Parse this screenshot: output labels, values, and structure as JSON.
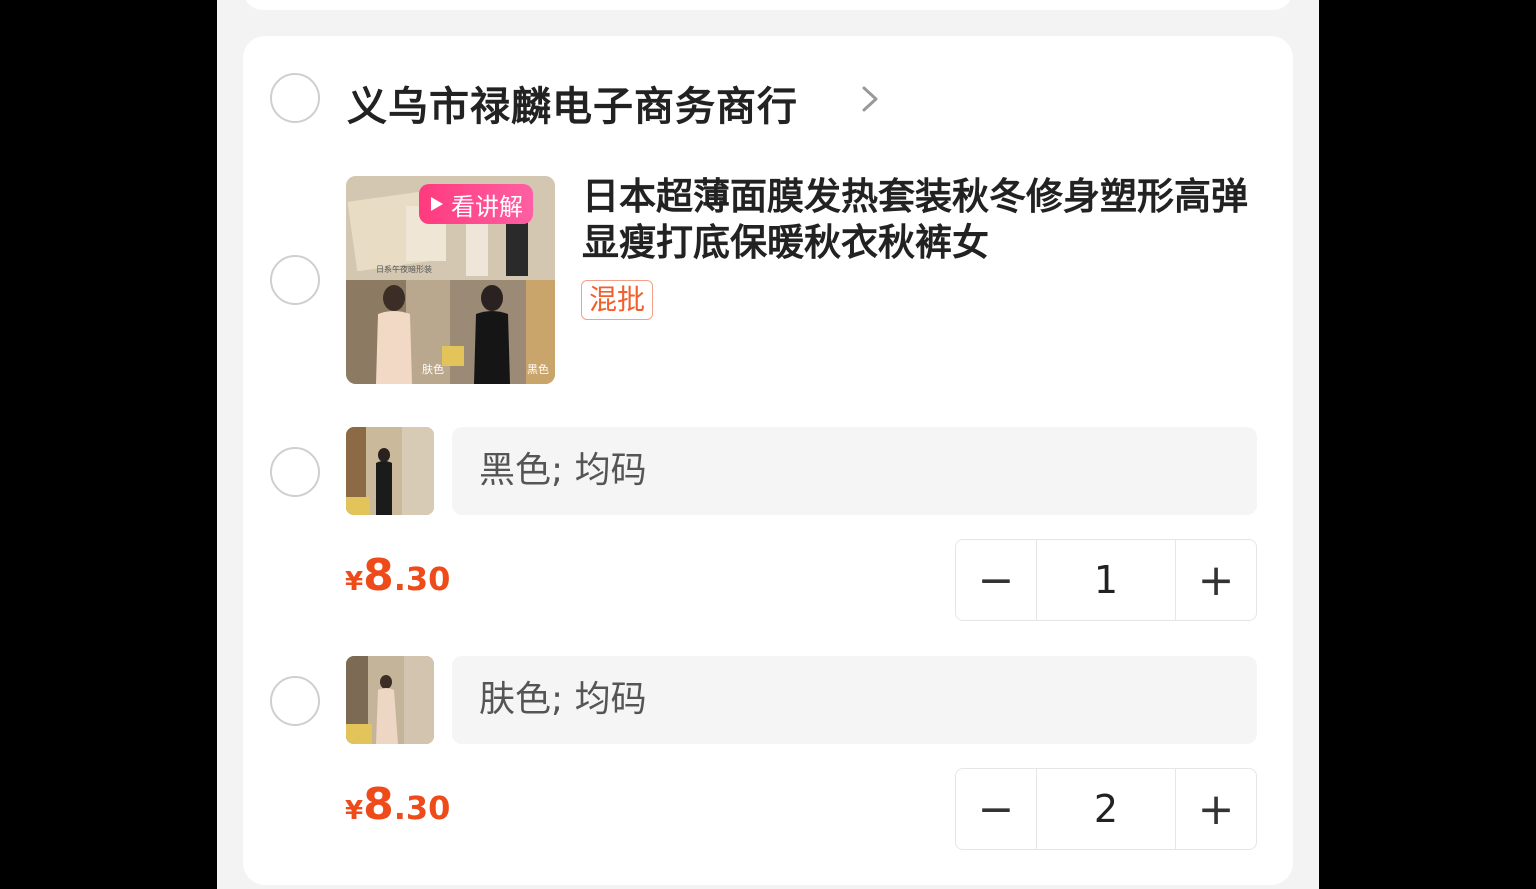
{
  "shop": {
    "name": "义乌市禄麟电子商务商行"
  },
  "product": {
    "video_badge": "看讲解",
    "title": "日本超薄面膜发热套装秋冬修身塑形高弹显瘦打底保暖秋衣秋裤女",
    "tag": "混批",
    "image_labels": [
      "日系午夜暗形装",
      "肤色",
      "黑色"
    ]
  },
  "skus": [
    {
      "spec": "黑色; 均码",
      "price_symbol": "¥",
      "price_int": "8",
      "price_dec": ".30",
      "quantity": "1",
      "minus": "−",
      "plus": "+"
    },
    {
      "spec": "肤色; 均码",
      "price_symbol": "¥",
      "price_int": "8",
      "price_dec": ".30",
      "quantity": "2",
      "minus": "−",
      "plus": "+"
    }
  ],
  "colors": {
    "price": "#ee4a1a",
    "badge": "#ff3a7e",
    "tag": "#f25f2d"
  }
}
